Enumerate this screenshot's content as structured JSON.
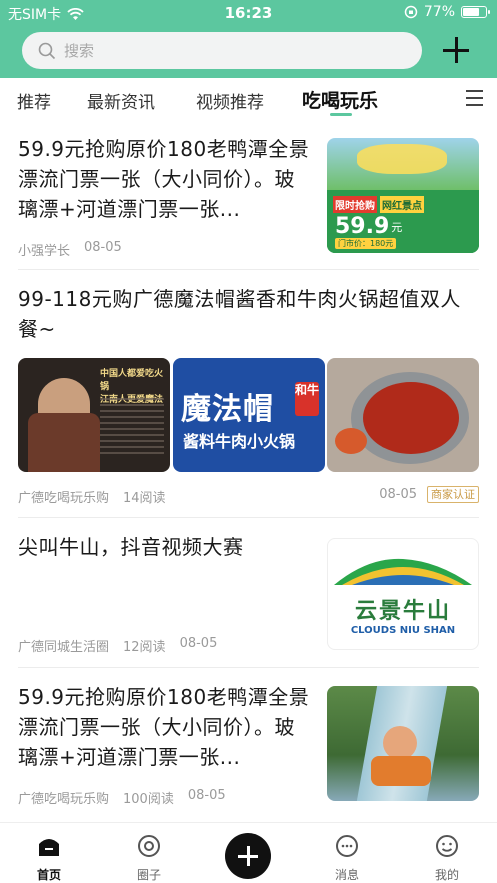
{
  "status": {
    "carrier": "无SIM卡",
    "time": "16:23",
    "battery": "77%",
    "battery_level": 0.77
  },
  "search": {
    "placeholder": "搜索"
  },
  "tabs": [
    {
      "label": "推荐"
    },
    {
      "label": "最新资讯"
    },
    {
      "label": "视频推荐"
    },
    {
      "label": "吃喝玩乐"
    }
  ],
  "feed": [
    {
      "title": "59.9元抢购原价180老鸭潭全景漂流门票一张（大小同价）。玻璃漂+河道漂门票一张...",
      "author": "小强学长",
      "reads": "",
      "date": "08-05",
      "thumb": {
        "tags": [
          "限时抢购",
          "网红景点"
        ],
        "price": "59.9",
        "price_unit": "元",
        "ticket": "门市价：180元"
      }
    },
    {
      "title": "99-118元购广德魔法帽酱香和牛肉火锅超值双人餐~",
      "author": "广德吃喝玩乐购",
      "reads": "14阅读",
      "date": "08-05",
      "badge": "商家认证",
      "images": [
        {
          "lines": [
            "中国人都爱吃火锅",
            "江南人更爱魔法"
          ]
        },
        {
          "line1": "魔法帽",
          "seal": "和牛",
          "line2": "酱料牛肉小火锅"
        },
        {}
      ]
    },
    {
      "title": "尖叫牛山，抖音视频大赛",
      "author": "广德同城生活圈",
      "reads": "12阅读",
      "date": "08-05",
      "thumb": {
        "cn": "云景牛山",
        "en": "CLOUDS NIU SHAN"
      }
    },
    {
      "title": "59.9元抢购原价180老鸭潭全景漂流门票一张（大小同价）。玻璃漂+河道漂门票一张...",
      "author": "广德吃喝玩乐购",
      "reads": "100阅读",
      "date": "08-05"
    }
  ],
  "nav": [
    {
      "label": "首页"
    },
    {
      "label": "圈子"
    },
    {
      "label": "消息"
    },
    {
      "label": "我的"
    }
  ],
  "colors": {
    "accent": "#5cc79f",
    "badge": "#c99a45"
  }
}
